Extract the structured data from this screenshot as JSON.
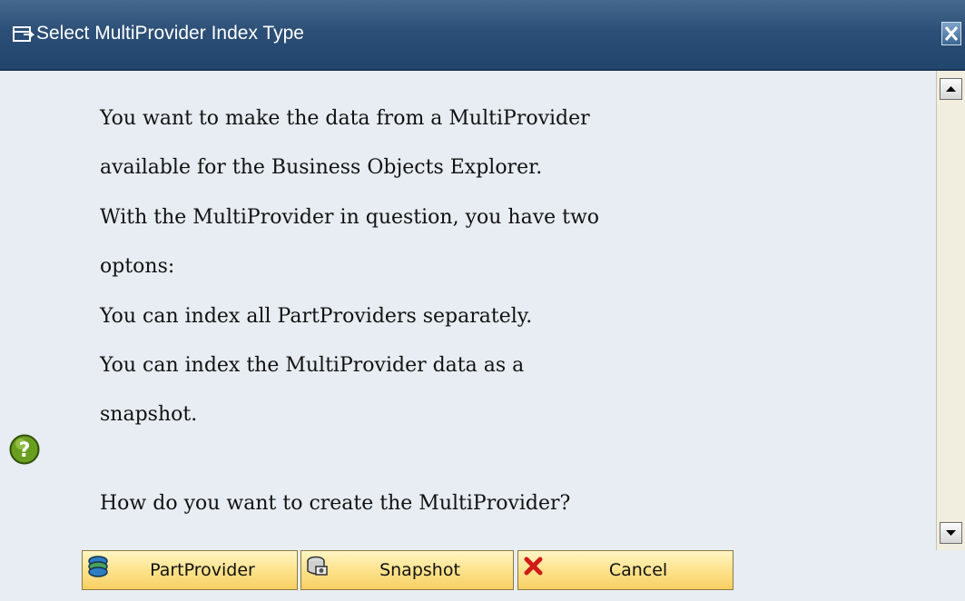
{
  "window": {
    "title": "Select MultiProvider Index Type",
    "title_icon": "dialog-icon",
    "close_icon": "close-icon"
  },
  "message": {
    "lines": [
      "You want to make the data from a MultiProvider",
      "available for the Business Objects Explorer.",
      "With the MultiProvider in question, you have two",
      "optons:",
      "You can index all PartProviders separately.",
      "You can index the MultiProvider data as a",
      "snapshot.",
      "How do you want to create the MultiProvider?"
    ],
    "icon": "question-icon"
  },
  "buttons": {
    "partprovider": {
      "label": "PartProvider",
      "icon": "partprovider-icon"
    },
    "snapshot": {
      "label": "Snapshot",
      "icon": "snapshot-icon"
    },
    "cancel": {
      "label": "Cancel",
      "icon": "cancel-x-icon"
    }
  },
  "colors": {
    "titlebar": "#2c4f77",
    "background": "#e7edf2",
    "button": "#fde189",
    "question_icon": "#6a9e1f",
    "cancel_icon": "#d11a1a"
  }
}
